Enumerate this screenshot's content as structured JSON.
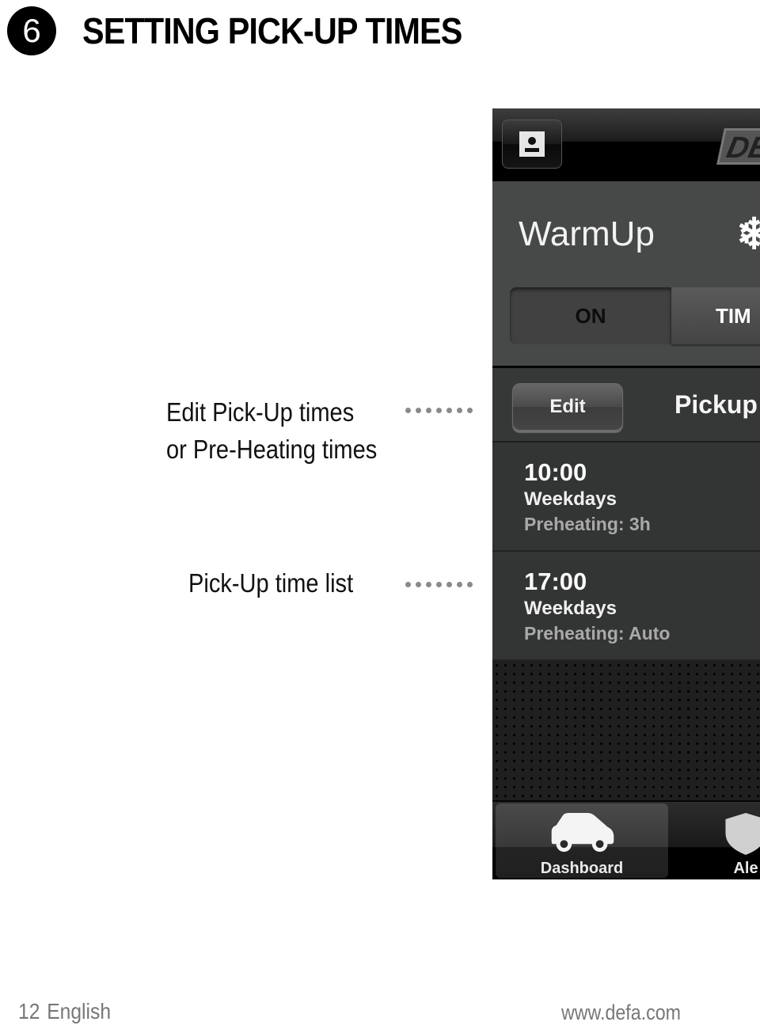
{
  "header": {
    "step_number": "6",
    "title": "SETTING PICK-UP TIMES"
  },
  "callouts": [
    {
      "lines": [
        "Edit Pick-Up times",
        "or Pre-Heating times"
      ],
      "target": "edit-button"
    },
    {
      "lines": [
        "Pick-Up time list"
      ],
      "target": "pickup-list"
    }
  ],
  "app": {
    "topbar": {
      "profile_icon": "profile-icon",
      "logo_text": "DE"
    },
    "warmup": {
      "title": "WarmUp",
      "status_icon": "snowflake-icon",
      "segments": [
        {
          "label": "ON",
          "selected": true
        },
        {
          "label": "TIM",
          "selected": false
        }
      ]
    },
    "pickup_list": {
      "edit_label": "Edit",
      "title": "Pickup",
      "items": [
        {
          "time": "10:00",
          "days": "Weekdays",
          "preheating": "Preheating: 3h"
        },
        {
          "time": "17:00",
          "days": "Weekdays",
          "preheating": "Preheating: Auto"
        }
      ]
    },
    "tabbar": {
      "tabs": [
        {
          "label": "Dashboard",
          "icon": "car-icon",
          "selected": true
        },
        {
          "label": "Ale",
          "icon": "shield-icon",
          "selected": false
        }
      ]
    }
  },
  "footer": {
    "page_number": "12",
    "language": "English",
    "url": "www.defa.com"
  }
}
